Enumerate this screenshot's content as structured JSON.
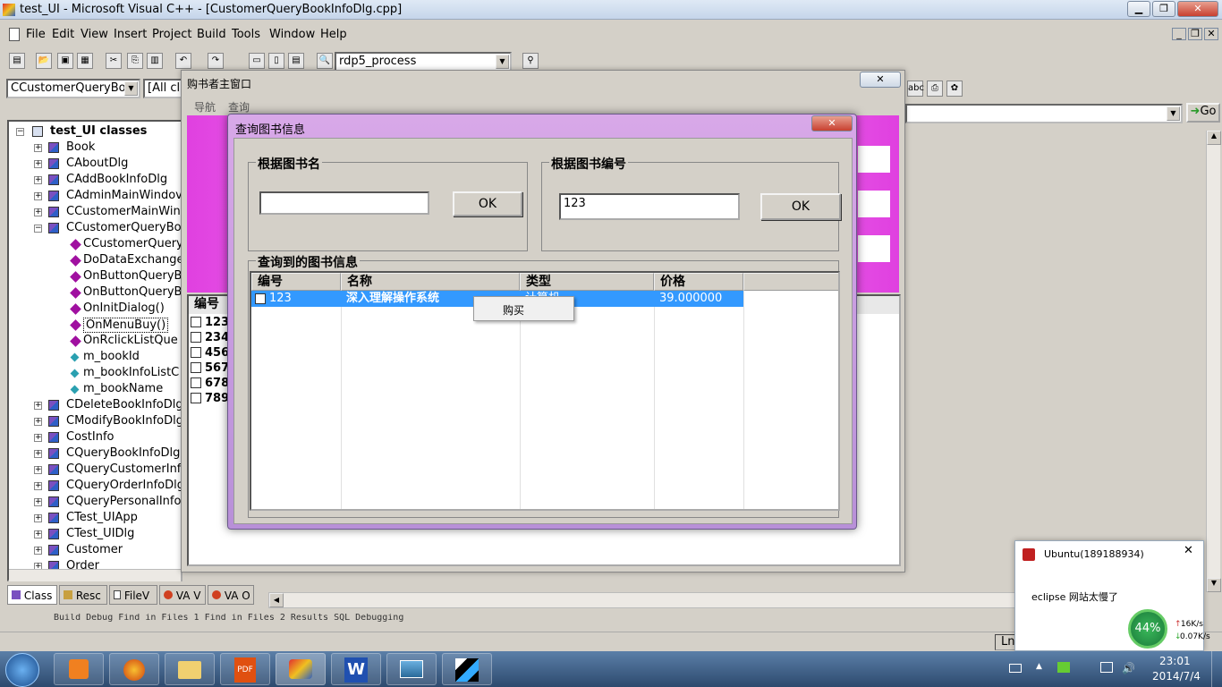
{
  "window": {
    "title": "test_UI - Microsoft Visual C++ - [CustomerQueryBookInfoDlg.cpp]"
  },
  "menu": [
    "File",
    "Edit",
    "View",
    "Insert",
    "Project",
    "Build",
    "Tools",
    "Window",
    "Help"
  ],
  "toolbar": {
    "config_combo": "rdp5_process",
    "class_combo": "CCustomerQueryBo",
    "filter_combo": "[All cl",
    "go_label": "Go"
  },
  "tree": {
    "root": "test_UI classes",
    "items": [
      {
        "label": "Book",
        "kind": "class",
        "level": 1,
        "pm": "+"
      },
      {
        "label": "CAboutDlg",
        "kind": "class",
        "level": 1,
        "pm": "+"
      },
      {
        "label": "CAddBookInfoDlg",
        "kind": "class",
        "level": 1,
        "pm": "+"
      },
      {
        "label": "CAdminMainWindov",
        "kind": "class",
        "level": 1,
        "pm": "+"
      },
      {
        "label": "CCustomerMainWin",
        "kind": "class",
        "level": 1,
        "pm": "+"
      },
      {
        "label": "CCustomerQueryBo",
        "kind": "class",
        "level": 1,
        "pm": "-"
      },
      {
        "label": "CCustomerQuery",
        "kind": "method",
        "level": 2
      },
      {
        "label": "DoDataExchange",
        "kind": "method",
        "level": 2
      },
      {
        "label": "OnButtonQueryB",
        "kind": "method",
        "level": 2
      },
      {
        "label": "OnButtonQueryB",
        "kind": "method",
        "level": 2
      },
      {
        "label": "OnInitDialog()",
        "kind": "method",
        "level": 2
      },
      {
        "label": "OnMenuBuy()",
        "kind": "method",
        "level": 2,
        "selected": true
      },
      {
        "label": "OnRclickListQue",
        "kind": "method",
        "level": 2
      },
      {
        "label": "m_bookId",
        "kind": "var",
        "level": 2
      },
      {
        "label": "m_bookInfoListC",
        "kind": "var",
        "level": 2
      },
      {
        "label": "m_bookName",
        "kind": "var",
        "level": 2
      },
      {
        "label": "CDeleteBookInfoDlg",
        "kind": "class",
        "level": 1,
        "pm": "+"
      },
      {
        "label": "CModifyBookInfoDlg",
        "kind": "class",
        "level": 1,
        "pm": "+"
      },
      {
        "label": "CostInfo",
        "kind": "class",
        "level": 1,
        "pm": "+"
      },
      {
        "label": "CQueryBookInfoDlg",
        "kind": "class",
        "level": 1,
        "pm": "+"
      },
      {
        "label": "CQueryCustomerInf",
        "kind": "class",
        "level": 1,
        "pm": "+"
      },
      {
        "label": "CQueryOrderInfoDlg",
        "kind": "class",
        "level": 1,
        "pm": "+"
      },
      {
        "label": "CQueryPersonalInfo",
        "kind": "class",
        "level": 1,
        "pm": "+"
      },
      {
        "label": "CTest_UIApp",
        "kind": "class",
        "level": 1,
        "pm": "+"
      },
      {
        "label": "CTest_UIDlg",
        "kind": "class",
        "level": 1,
        "pm": "+"
      },
      {
        "label": "Customer",
        "kind": "class",
        "level": 1,
        "pm": "+"
      },
      {
        "label": "Order",
        "kind": "class",
        "level": 1,
        "pm": "+"
      }
    ]
  },
  "workspace_tabs": [
    "Class",
    "Resc",
    "FileV",
    "VA V",
    "VA O"
  ],
  "output_tabs": "Build  Debug  Find in Files 1  Find in Files 2  Results  SQL Debugging",
  "parent_window": {
    "title": "购书者主窗口",
    "menu": [
      "导航",
      "查询"
    ],
    "list_header": "编号",
    "list_rows": [
      "123",
      "234",
      "456",
      "567",
      "678",
      "789"
    ]
  },
  "dialog": {
    "title": "查询图书信息",
    "group_name": {
      "label": "根据图书名",
      "value": "",
      "ok": "OK"
    },
    "group_id": {
      "label": "根据图书编号",
      "value": "123",
      "ok": "OK"
    },
    "results_label": "查询到的图书信息",
    "columns": [
      "编号",
      "名称",
      "类型",
      "价格"
    ],
    "rows": [
      {
        "id": "123",
        "name": "深入理解操作系统",
        "type": "计算机",
        "price": "39.000000"
      }
    ],
    "context_menu": "购买"
  },
  "notification": {
    "title": "Ubuntu(189188934)",
    "message": "eclipse 网站太慢了",
    "gauge": "44%",
    "up": "16K/s",
    "down": "0.07K/s"
  },
  "status": {
    "ln": "Ln"
  },
  "clock": {
    "time": "23:01",
    "date": "2014/7/4"
  }
}
